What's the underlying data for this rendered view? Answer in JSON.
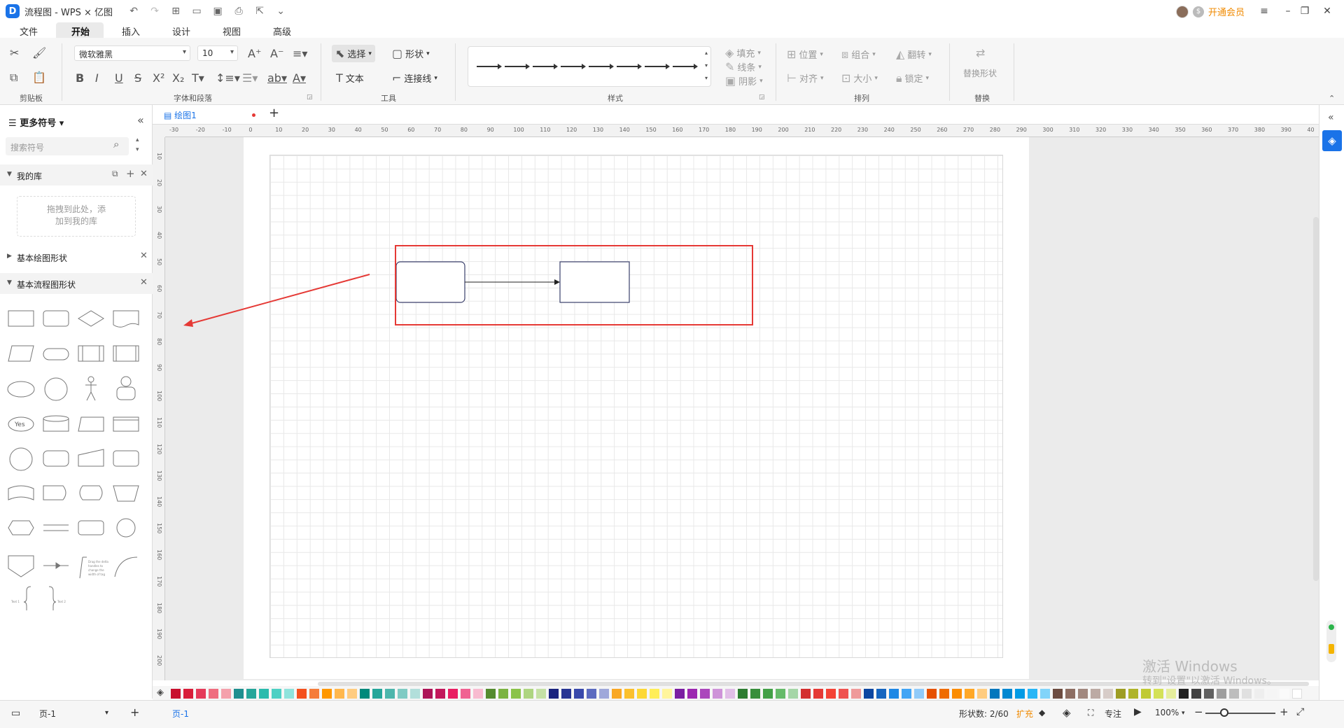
{
  "titlebar": {
    "app_title": "流程图 - WPS × 亿图",
    "vip_label": "开通会员"
  },
  "menu_tabs": [
    "文件",
    "开始",
    "插入",
    "设计",
    "视图",
    "高级"
  ],
  "ribbon": {
    "clipboard_label": "剪贴板",
    "font_name": "微软雅黑",
    "font_size": "10",
    "font_group_label": "字体和段落",
    "select_label": "选择",
    "shape_label": "形状",
    "text_label": "文本",
    "connector_label": "连接线",
    "tools_label": "工具",
    "styles_label": "样式",
    "fill_label": "填充",
    "line_label": "线条",
    "shadow_label": "阴影",
    "position_label": "位置",
    "group_label": "组合",
    "flip_label": "翻转",
    "align_label": "对齐",
    "size_label": "大小",
    "lock_label": "锁定",
    "arrange_label": "排列",
    "replace_shape_label": "替换形状",
    "replace_label": "替换"
  },
  "left_panel": {
    "title": "更多符号",
    "search_placeholder": "搜索符号",
    "my_library": "我的库",
    "drop_hint_line1": "拖拽到此处，添",
    "drop_hint_line2": "加到我的库",
    "basic_drawing": "基本绘图形状",
    "basic_flowchart": "基本流程图形状",
    "yes_label": "Yes"
  },
  "doc": {
    "tab_name": "绘图1"
  },
  "ruler": {
    "h_ticks": [
      "-30",
      "-20",
      "-10",
      "0",
      "10",
      "20",
      "30",
      "40",
      "50",
      "60",
      "70",
      "80",
      "90",
      "100",
      "110",
      "120",
      "130",
      "140",
      "150",
      "160",
      "170",
      "180",
      "190",
      "200",
      "210",
      "220",
      "230",
      "240",
      "250",
      "260",
      "270",
      "280",
      "290",
      "300",
      "310",
      "320",
      "330",
      "340",
      "350",
      "360",
      "370",
      "380",
      "390",
      "40"
    ],
    "v_ticks": [
      "10",
      "20",
      "30",
      "40",
      "50",
      "60",
      "70",
      "80",
      "90",
      "100",
      "110",
      "120",
      "130",
      "140",
      "150",
      "160",
      "170",
      "180",
      "190",
      "200"
    ]
  },
  "watermark": {
    "line1": "激活 Windows",
    "line2": "转到\"设置\"以激活 Windows。"
  },
  "statusbar": {
    "page_name": "页-1",
    "page_tab": "页-1",
    "shape_count": "形状数: 2/60",
    "expand": "扩充",
    "focus": "专注",
    "zoom": "100%"
  },
  "palette": [
    "#c8102e",
    "#d81e3a",
    "#e53b5a",
    "#ef6d7f",
    "#f4a0ab",
    "#1f8f8f",
    "#26a69a",
    "#2bbbad",
    "#4dd0c4",
    "#8fe3dc",
    "#f4511e",
    "#f57c3a",
    "#ff9800",
    "#ffb74d",
    "#ffcc80",
    "#00897b",
    "#26a69a",
    "#4db6ac",
    "#80cbc4",
    "#b2dfdb",
    "#ad1457",
    "#c2185b",
    "#e91e63",
    "#f06292",
    "#f8bbd0",
    "#558b2f",
    "#7cb342",
    "#8bc34a",
    "#aed581",
    "#c5e1a5",
    "#1a237e",
    "#283593",
    "#3949ab",
    "#5c6bc0",
    "#9fa8da",
    "#f9a825",
    "#fbc02d",
    "#fdd835",
    "#ffee58",
    "#fff59d",
    "#7b1fa2",
    "#9c27b0",
    "#ab47bc",
    "#ce93d8",
    "#e1bee7",
    "#2e7d32",
    "#388e3c",
    "#43a047",
    "#66bb6a",
    "#a5d6a7",
    "#d32f2f",
    "#e53935",
    "#f44336",
    "#ef5350",
    "#ef9a9a",
    "#0d47a1",
    "#1565c0",
    "#1e88e5",
    "#42a5f5",
    "#90caf9",
    "#e65100",
    "#ef6c00",
    "#fb8c00",
    "#ffa726",
    "#ffcc80",
    "#0277bd",
    "#0288d1",
    "#039be5",
    "#29b6f6",
    "#81d4fa",
    "#6d4c41",
    "#8d6e63",
    "#a1887f",
    "#bcaaa4",
    "#d7ccc8",
    "#9e9d24",
    "#afb42b",
    "#c0ca33",
    "#d4e157",
    "#e6ee9c",
    "#212121",
    "#424242",
    "#616161",
    "#9e9e9e",
    "#bdbdbd",
    "#e0e0e0",
    "#eeeeee",
    "#f5f5f5",
    "#fafafa",
    "#ffffff"
  ]
}
